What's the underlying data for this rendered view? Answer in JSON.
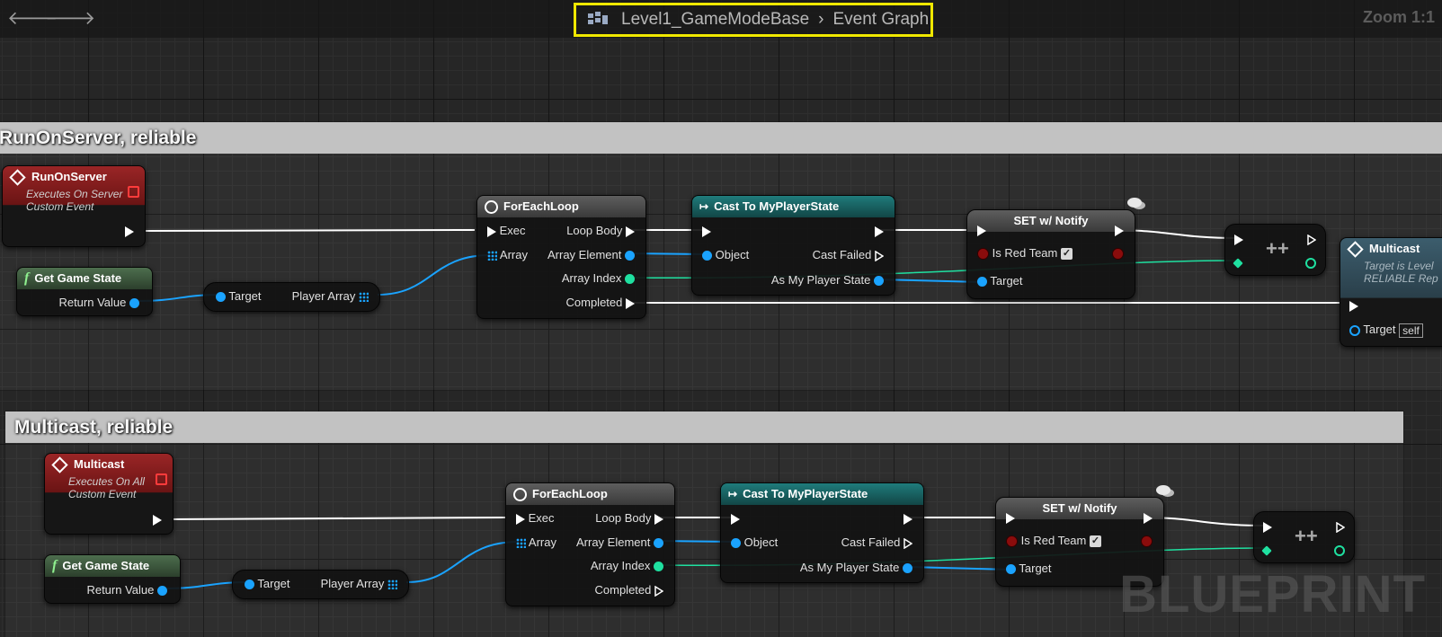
{
  "toolbar": {
    "back_icon": "arrow-left-icon",
    "forward_icon": "arrow-right-icon",
    "breadcrumb_blueprint": "Level1_GameModeBase",
    "breadcrumb_graph": "Event Graph",
    "zoom": "Zoom 1:1"
  },
  "watermark": "BLUEPRINT",
  "colors": {
    "highlight": "#f0e800",
    "event_red": "#9a2526",
    "cast_teal": "#1f7b7b",
    "exec": "#ffffff",
    "object_pin": "#1aa3ff",
    "int_pin": "#1fe0a0"
  },
  "comment1": {
    "title": "RunOnServer, reliable",
    "event": {
      "title": "RunOnServer",
      "line1": "Executes On Server",
      "line2": "Custom Event"
    },
    "get_game_state": {
      "title": "Get Game State",
      "return_value": "Return Value"
    },
    "player_array": {
      "target": "Target",
      "output": "Player Array"
    },
    "foreach": {
      "title": "ForEachLoop",
      "exec": "Exec",
      "array": "Array",
      "loop_body": "Loop Body",
      "array_element": "Array Element",
      "array_index": "Array Index",
      "completed": "Completed"
    },
    "cast": {
      "title": "Cast To MyPlayerState",
      "object": "Object",
      "cast_failed": "Cast Failed",
      "as_state": "As My Player State"
    },
    "set": {
      "title": "SET w/ Notify",
      "is_red": "Is Red Team",
      "target": "Target"
    },
    "increment": {
      "label": "++"
    },
    "multicast_call": {
      "title": "Multicast",
      "line1": "Target is Level",
      "line2": "RELIABLE Rep",
      "target": "Target",
      "self": "self"
    }
  },
  "comment2": {
    "title": "Multicast, reliable",
    "event": {
      "title": "Multicast",
      "line1": "Executes On All",
      "line2": "Custom Event"
    },
    "get_game_state": {
      "title": "Get Game State",
      "return_value": "Return Value"
    },
    "player_array": {
      "target": "Target",
      "output": "Player Array"
    },
    "foreach": {
      "title": "ForEachLoop",
      "exec": "Exec",
      "array": "Array",
      "loop_body": "Loop Body",
      "array_element": "Array Element",
      "array_index": "Array Index",
      "completed": "Completed"
    },
    "cast": {
      "title": "Cast To MyPlayerState",
      "object": "Object",
      "cast_failed": "Cast Failed",
      "as_state": "As My Player State"
    },
    "set": {
      "title": "SET w/ Notify",
      "is_red": "Is Red Team",
      "target": "Target"
    },
    "increment": {
      "label": "++"
    }
  }
}
